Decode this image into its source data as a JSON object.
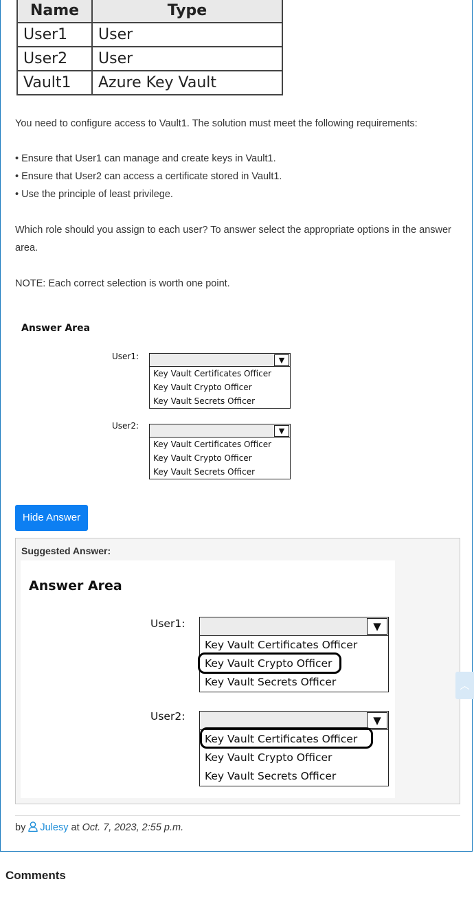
{
  "table": {
    "headers": [
      "Name",
      "Type"
    ],
    "rows": [
      [
        "User1",
        "User"
      ],
      [
        "User2",
        "User"
      ],
      [
        "Vault1",
        "Azure Key Vault"
      ]
    ]
  },
  "question": {
    "intro": "You need to configure access to Vault1. The solution must meet the following requirements:",
    "requirements": [
      "• Ensure that User1 can manage and create keys in Vault1.",
      "• Ensure that User2 can access a certificate stored in Vault1.",
      "• Use the principle of least privilege."
    ],
    "prompt_line1": "Which role should you assign to each user? To answer select the appropriate options in the answer",
    "prompt_line2": "area.",
    "note": "NOTE: Each correct selection is worth one point."
  },
  "answer_area": {
    "title": "Answer Area",
    "user1_label": "User1:",
    "user2_label": "User2:",
    "options": [
      "Key Vault Certificates Officer",
      "Key Vault Crypto Officer",
      "Key Vault Secrets Officer"
    ]
  },
  "toggle_button": "Hide Answer",
  "suggested": {
    "title": "Suggested Answer:",
    "area_title": "Answer Area",
    "user1_label": "User1:",
    "user2_label": "User2:",
    "options": [
      "Key Vault Certificates Officer",
      "Key Vault Crypto Officer",
      "Key Vault Secrets Officer"
    ],
    "user1_selected": "Key Vault Crypto Officer",
    "user2_selected": "Key Vault Certificates Officer"
  },
  "byline": {
    "by": "by",
    "user": "Julesy",
    "at": "at",
    "date": "Oct. 7, 2023, 2:55 p.m."
  },
  "comments_heading": "Comments",
  "icons": {
    "user": "user-icon",
    "scroll_top": "chevron-up-icon",
    "dropdown": "triangle-down-icon"
  },
  "colors": {
    "button": "#0d7ff2",
    "frame": "#1a7bbf",
    "link": "#1a8cd8"
  }
}
